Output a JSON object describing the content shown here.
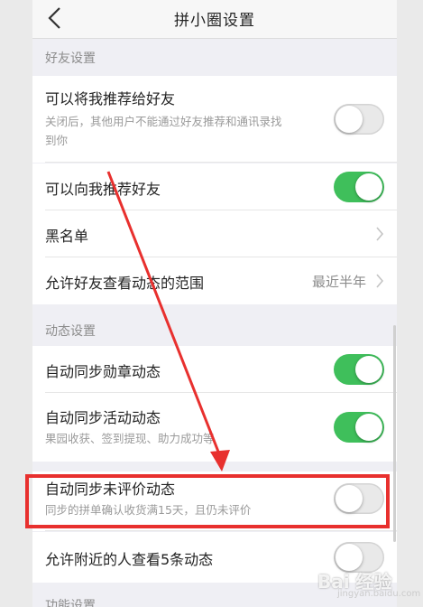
{
  "nav": {
    "title": "拼小圈设置"
  },
  "sections": {
    "friends": "好友设置",
    "dynamics": "动态设置",
    "features": "功能设置"
  },
  "rows": {
    "recommend_me": {
      "title": "可以将我推荐给好友",
      "subtitle_line1": "关闭后，其他用户不能通过好友推荐和通讯录找",
      "subtitle_line2": "到你",
      "enabled": false
    },
    "recommend_friends": {
      "title": "可以向我推荐好友",
      "enabled": true
    },
    "blacklist": {
      "title": "黑名单"
    },
    "visible_range": {
      "title": "允许好友查看动态的范围",
      "value": "最近半年"
    },
    "sync_badge": {
      "title": "自动同步勋章动态",
      "enabled": true
    },
    "sync_activity": {
      "title": "自动同步活动动态",
      "subtitle": "果园收获、签到提现、助力成功等",
      "enabled": true
    },
    "sync_unreviewed": {
      "title": "自动同步未评价动态",
      "subtitle": "同步的拼单确认收货满15天，且仍未评价",
      "enabled": false
    },
    "nearby_view": {
      "title": "允许附近的人查看5条动态",
      "enabled": false
    }
  },
  "watermark": {
    "text": "Bai 经验",
    "sub": "jingyan.baidu.com"
  },
  "colors": {
    "toggle_on": "#3fbf5b",
    "annotation": "#e8302e"
  }
}
